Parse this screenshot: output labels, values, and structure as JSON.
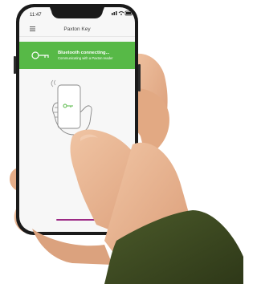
{
  "status_bar": {
    "time": "11:47"
  },
  "app": {
    "title": "Paxton Key",
    "banner": {
      "heading": "Bluetooth connecting...",
      "subtext": "Communicating with a Paxton reader"
    }
  },
  "colors": {
    "banner_green": "#57b947",
    "phone_frame": "#1a1a1a",
    "screen_bg": "#f7f7f7",
    "skin": "#e7b491",
    "sleeve": "#3e4a22"
  },
  "icons": [
    "hamburger-menu-icon",
    "key-icon",
    "phone-in-hand-illustration",
    "wifi-icon",
    "signal-icon",
    "battery-icon"
  ]
}
